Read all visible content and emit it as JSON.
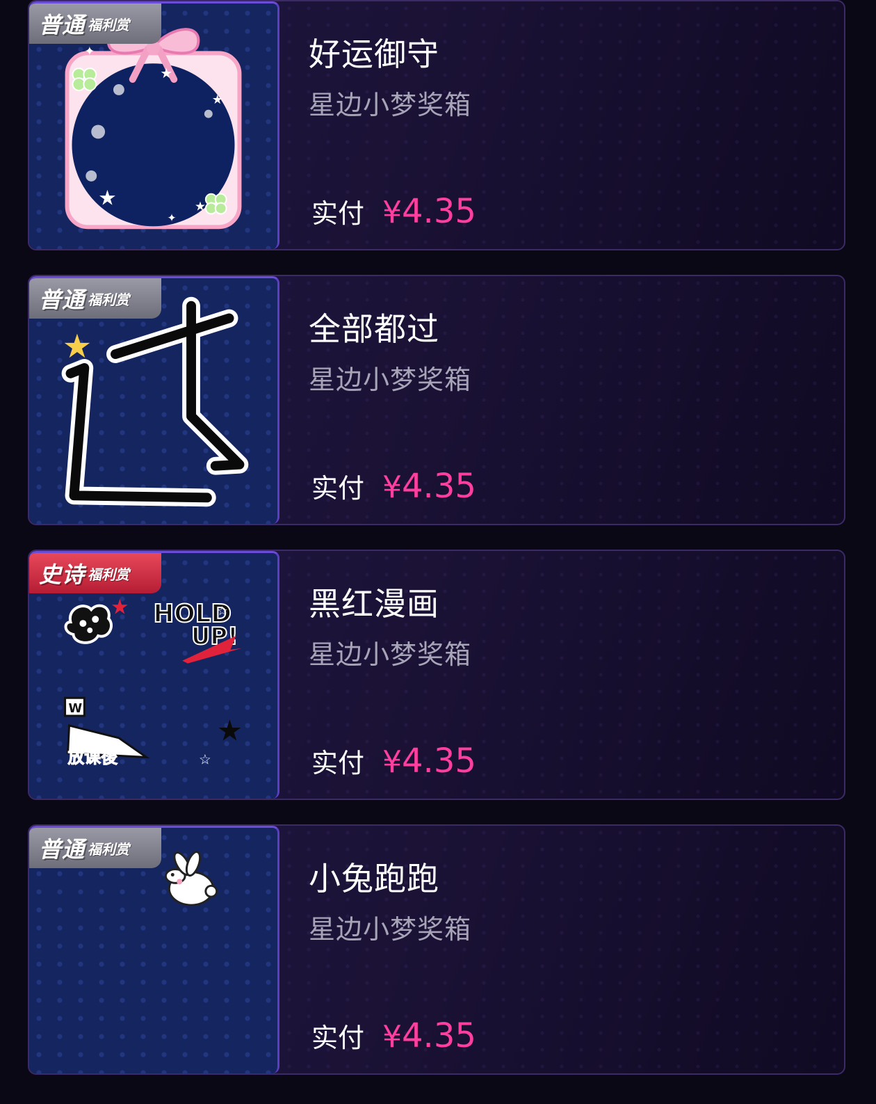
{
  "items": [
    {
      "tier_big": "普通",
      "tier_small": "福利赏",
      "tier": "normal",
      "title": "好运御守",
      "subtitle": "星边小梦奖箱",
      "price_label": "实付",
      "currency": "¥",
      "price": "4.35",
      "thumb_icon": "omamori-frame-icon"
    },
    {
      "tier_big": "普通",
      "tier_small": "福利赏",
      "tier": "normal",
      "title": "全部都过",
      "subtitle": "星边小梦奖箱",
      "price_label": "实付",
      "currency": "¥",
      "price": "4.35",
      "thumb_icon": "guo-character-icon"
    },
    {
      "tier_big": "史诗",
      "tier_small": "福利赏",
      "tier": "epic",
      "title": "黑红漫画",
      "subtitle": "星边小梦奖箱",
      "price_label": "实付",
      "currency": "¥",
      "price": "4.35",
      "thumb_icon": "comic-stickers-icon",
      "art_text": {
        "hold": "HOLD",
        "up": "UP!",
        "w": "W",
        "after_school": "放课後"
      }
    },
    {
      "tier_big": "普通",
      "tier_small": "福利赏",
      "tier": "normal",
      "title": "小兔跑跑",
      "subtitle": "星边小梦奖箱",
      "price_label": "实付",
      "currency": "¥",
      "price": "4.35",
      "thumb_icon": "bunny-icon"
    }
  ],
  "colors": {
    "price": "#ff3fa0",
    "epic": "#d42a44",
    "normal": "#85858f",
    "accent_border": "#6a4cd6"
  }
}
